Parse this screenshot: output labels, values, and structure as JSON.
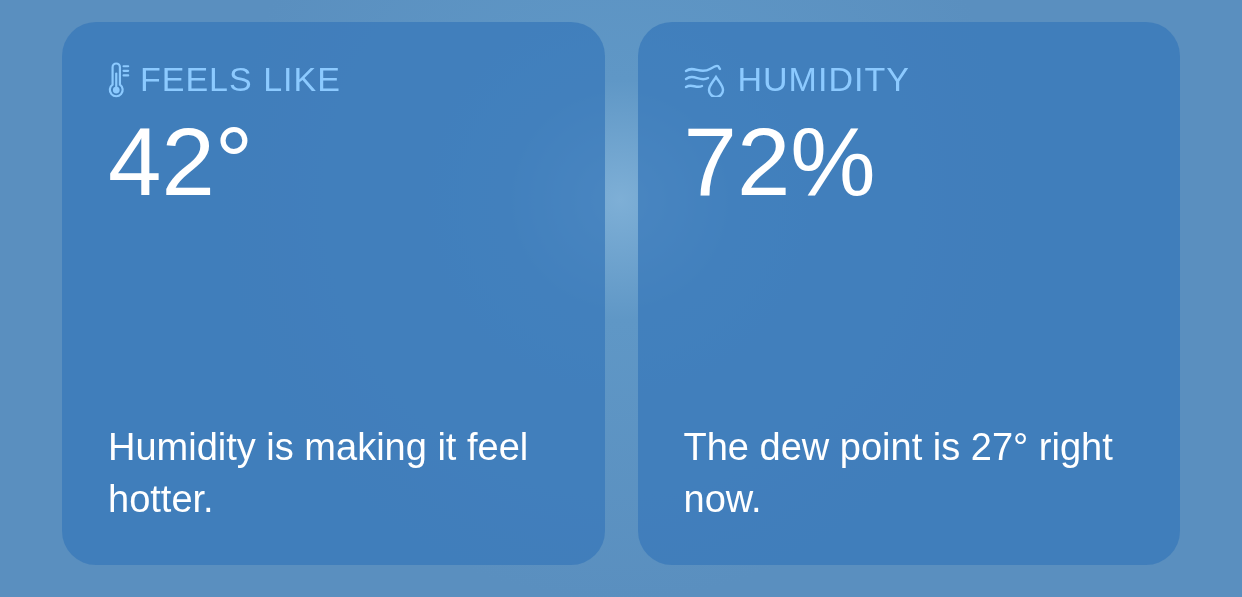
{
  "cards": [
    {
      "kind": "thermometer",
      "title": "FEELS LIKE",
      "value": "42°",
      "description": "Humidity is making it feel hotter."
    },
    {
      "kind": "humidity",
      "title": "HUMIDITY",
      "value": "72%",
      "description": "The dew point is 27° right now."
    }
  ]
}
